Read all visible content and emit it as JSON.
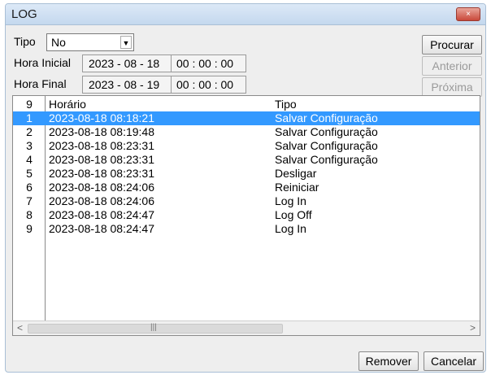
{
  "window": {
    "title": "LOG",
    "close_label": "×"
  },
  "filter": {
    "tipo_label": "Tipo",
    "tipo_value": "No",
    "hora_inicial_label": "Hora Inicial",
    "hora_inicial_date": "2023 - 08 - 18",
    "hora_inicial_time": "00 : 00 : 00",
    "hora_final_label": "Hora Final",
    "hora_final_date": "2023 - 08 - 19",
    "hora_final_time": "00 : 00 : 00"
  },
  "buttons": {
    "procurar": "Procurar",
    "anterior": "Anterior",
    "proxima": "Próxima",
    "remover": "Remover",
    "cancelar": "Cancelar"
  },
  "table": {
    "header": {
      "count": "9",
      "time": "Horário",
      "type": "Tipo"
    },
    "rows": [
      {
        "idx": "1",
        "time": "2023-08-18 08:18:21",
        "type": "Salvar Configuração",
        "selected": true
      },
      {
        "idx": "2",
        "time": "2023-08-18 08:19:48",
        "type": "Salvar Configuração"
      },
      {
        "idx": "3",
        "time": "2023-08-18 08:23:31",
        "type": "Salvar Configuração"
      },
      {
        "idx": "4",
        "time": "2023-08-18 08:23:31",
        "type": "Salvar Configuração"
      },
      {
        "idx": "5",
        "time": "2023-08-18 08:23:31",
        "type": "Desligar"
      },
      {
        "idx": "6",
        "time": "2023-08-18 08:24:06",
        "type": "Reiniciar"
      },
      {
        "idx": "7",
        "time": "2023-08-18 08:24:06",
        "type": "Log In"
      },
      {
        "idx": "8",
        "time": "2023-08-18 08:24:47",
        "type": "Log Off"
      },
      {
        "idx": "9",
        "time": "2023-08-18 08:24:47",
        "type": "Log In"
      }
    ]
  },
  "colors": {
    "selection": "#3399ff",
    "titlebar": "#c4d8ee",
    "close": "#c9483a"
  },
  "icons": {
    "close": "close-icon",
    "dropdown": "chevron-down-icon",
    "scroll_left": "arrow-left-icon",
    "scroll_right": "arrow-right-icon"
  }
}
